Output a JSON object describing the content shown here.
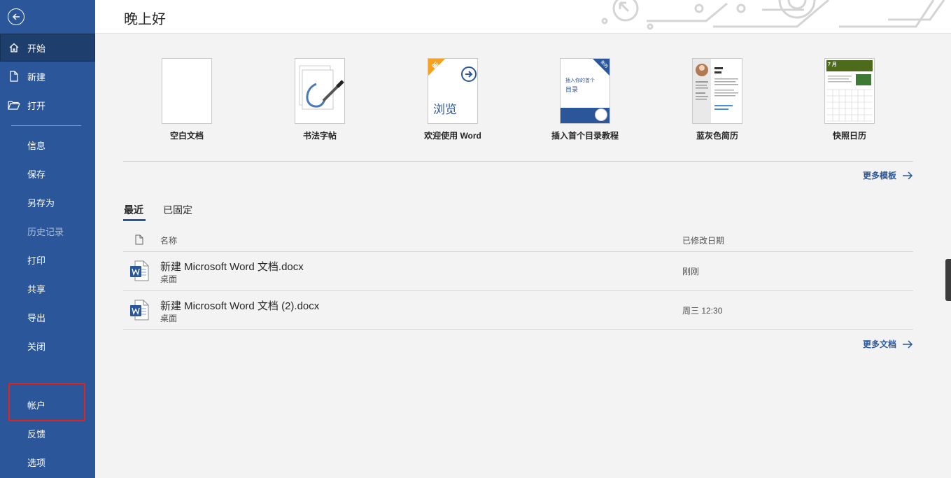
{
  "sidebar": {
    "nav": {
      "home": "开始",
      "new": "新建",
      "open": "打开",
      "info": "信息",
      "save": "保存",
      "save_as": "另存为",
      "history": "历史记录",
      "print": "打印",
      "share": "共享",
      "export": "导出",
      "close": "关闭",
      "account": "帐户",
      "feedback": "反馈",
      "options": "选项"
    },
    "active_item": "开始",
    "highlighted_item": "帐户"
  },
  "header": {
    "greeting": "晚上好"
  },
  "templates": {
    "items": [
      {
        "label": "空白文档"
      },
      {
        "label": "书法字帖"
      },
      {
        "label": "欢迎使用 Word",
        "badge": "新",
        "thumb_text": "浏览"
      },
      {
        "label": "插入首个目录教程",
        "thumb_line1": "插入你的首个",
        "thumb_line2": "目录",
        "corner": "新的"
      },
      {
        "label": "蓝灰色简历"
      },
      {
        "label": "快照日历",
        "thumb_month": "7 月"
      }
    ],
    "more_label": "更多模板"
  },
  "recent": {
    "tabs": [
      "最近",
      "已固定"
    ],
    "active_tab": "最近",
    "columns": {
      "name": "名称",
      "modified": "已修改日期"
    },
    "files": [
      {
        "name": "新建 Microsoft Word 文档.docx",
        "location": "桌面",
        "modified": "刚刚",
        "icon": "word-doc-icon"
      },
      {
        "name": "新建 Microsoft Word 文档 (2).docx",
        "location": "桌面",
        "modified": "周三 12:30",
        "icon": "word-doc-icon"
      }
    ],
    "more_label": "更多文档"
  },
  "colors": {
    "sidebar": "#2b579a",
    "sidebar_active": "#1e3f6e",
    "highlight": "#e2231a",
    "accent": "#2b579a",
    "badge": "#f6a21e"
  }
}
